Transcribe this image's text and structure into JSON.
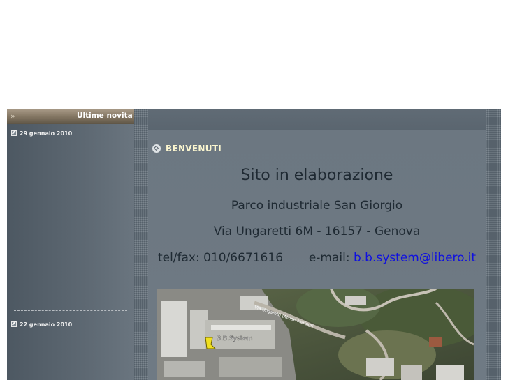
{
  "sidebar": {
    "header_title": "Ultime novita :",
    "header_arrows": "»",
    "news": [
      {
        "date": "29 gennaio 2010"
      },
      {
        "date": "22 gennaio 2010"
      }
    ]
  },
  "main": {
    "section_title": "BENVENUTI",
    "status": "Sito in elaborazione",
    "park": "Parco industriale San Giorgio",
    "address": "Via Ungaretti 6M - 16157 - Genova",
    "contact_label": "tel/fax: 010/6671616",
    "email_label": "e-mail: ",
    "email": "b.b.system@libero.it",
    "map": {
      "marker_label": "B.B.System",
      "street_label": "Via Ungaretti (Alcide Meriggi)"
    }
  },
  "colors": {
    "accent_title": "#fbf6cf",
    "link": "#1010e0",
    "frame": "#55606a"
  }
}
